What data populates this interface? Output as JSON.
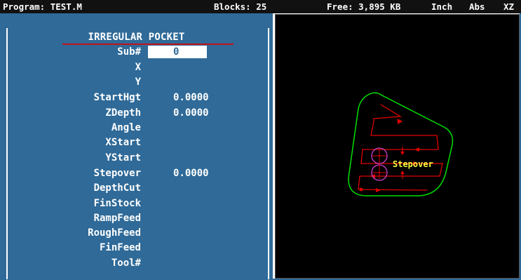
{
  "status_bar": {
    "program": "Program: TEST.M",
    "blocks": "Blocks: 25",
    "free": "Free: 3,895 KB",
    "units": "Inch",
    "mode": "Abs",
    "plane": "XZ"
  },
  "form": {
    "title": "IRREGULAR POCKET",
    "fields": [
      {
        "label": "Sub#",
        "value": "0"
      },
      {
        "label": "X",
        "value": ""
      },
      {
        "label": "Y",
        "value": ""
      },
      {
        "label": "StartHgt",
        "value": "0.0000"
      },
      {
        "label": "ZDepth",
        "value": "0.0000"
      },
      {
        "label": "Angle",
        "value": ""
      },
      {
        "label": "XStart",
        "value": ""
      },
      {
        "label": "YStart",
        "value": ""
      },
      {
        "label": "Stepover",
        "value": "0.0000"
      },
      {
        "label": "DepthCut",
        "value": ""
      },
      {
        "label": "FinStock",
        "value": ""
      },
      {
        "label": "RampFeed",
        "value": ""
      },
      {
        "label": "RoughFeed",
        "value": ""
      },
      {
        "label": "FinFeed",
        "value": ""
      },
      {
        "label": "Tool#",
        "value": ""
      }
    ]
  },
  "graphic": {
    "annotation": "Stepover",
    "colors": {
      "boundary": "#00e000",
      "toolpath": "#e00000",
      "tool": "#d040d0",
      "annotation": "#ffff40",
      "background": "#000000",
      "panel": "#2f6a98"
    }
  }
}
